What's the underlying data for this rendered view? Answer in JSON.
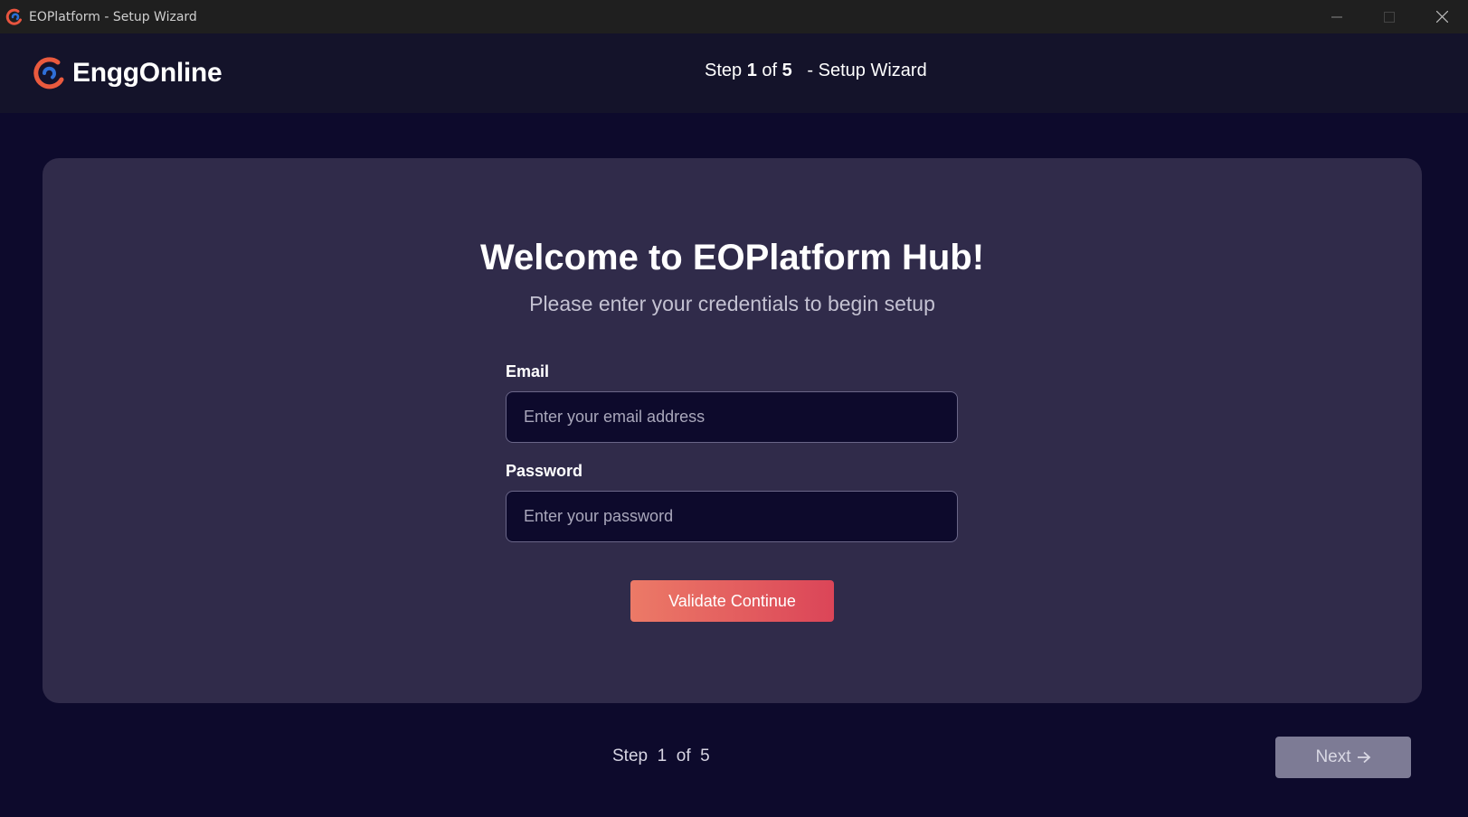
{
  "window": {
    "title": "EOPlatform - Setup Wizard"
  },
  "header": {
    "brand_name": "EnggOnline",
    "step_prefix": "Step ",
    "step_current": "1",
    "step_of": " of ",
    "step_total": "5",
    "step_suffix": "   - Setup Wizard"
  },
  "main": {
    "heading": "Welcome to EOPlatform Hub!",
    "subtitle": "Please enter your credentials to begin setup",
    "email": {
      "label": "Email",
      "placeholder": "Enter your email address",
      "value": ""
    },
    "password": {
      "label": "Password",
      "placeholder": "Enter your password",
      "value": ""
    },
    "validate_label": "Validate Continue"
  },
  "footer": {
    "step_text": "Step  1  of  5",
    "next_label": "Next"
  },
  "icons": {
    "logo": "enggonline-logo-icon",
    "minimize": "minimize-icon",
    "maximize": "maximize-icon",
    "close": "close-icon",
    "next_arrow": "arrow-right-icon"
  },
  "colors": {
    "background": "#0d0a2c",
    "card": "#302b4a",
    "accent_start": "#ec7a67",
    "accent_end": "#db4558",
    "next_button": "#7d7b95"
  }
}
